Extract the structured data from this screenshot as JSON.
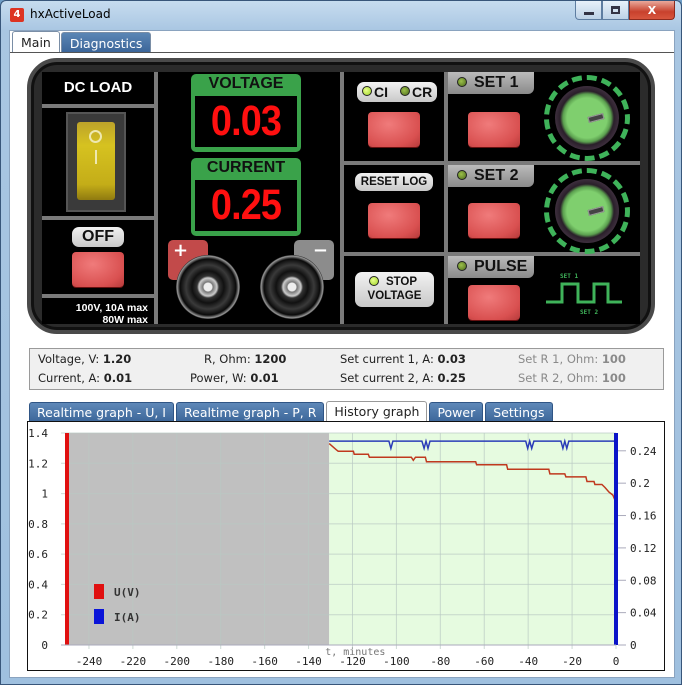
{
  "window": {
    "title": "hxActiveLoad",
    "app_icon": "app-logo-icon",
    "controls": {
      "minimize": "—",
      "maximize": "▫",
      "close": "X"
    }
  },
  "main_tabs": [
    {
      "label": "Main",
      "active": true
    },
    {
      "label": "Diagnostics",
      "active": false
    }
  ],
  "panel": {
    "title": "DC LOAD",
    "power_switch": {
      "icon": "rocker-switch-icon",
      "state": "on"
    },
    "off_button_label": "OFF",
    "specs": [
      "100V, 10A max",
      "80W max"
    ],
    "voltage": {
      "label": "VOLTAGE",
      "value": "0.03"
    },
    "current": {
      "label": "CURRENT",
      "value": "0.25"
    },
    "terminals": {
      "positive": "+",
      "negative": "−"
    },
    "mode_indicator": {
      "ci_label": "CI",
      "cr_label": "CR",
      "ci_lit": true,
      "cr_lit": false
    },
    "reset_log_label": "RESET LOG",
    "stop_voltage_label_1": "STOP",
    "stop_voltage_label_2": "VOLTAGE",
    "set1_label": "SET 1",
    "set2_label": "SET 2",
    "pulse_label": "PULSE",
    "pulse_diagram": {
      "top_label": "SET 1",
      "bottom_label": "SET 2"
    },
    "colors": {
      "display_red": "#ff1010",
      "meter_green": "#3aa24a",
      "button_red": "#d95050"
    }
  },
  "info": {
    "voltage_label": "Voltage, V:",
    "voltage_value": "1.20",
    "current_label": "Current, A:",
    "current_value": "0.01",
    "r_label": "R, Ohm:",
    "r_value": "1200",
    "power_label": "Power, W:",
    "power_value": "0.01",
    "set_current1_label": "Set current 1, A:",
    "set_current1_value": "0.03",
    "set_current2_label": "Set current 2, A:",
    "set_current2_value": "0.25",
    "set_r1_label": "Set R 1, Ohm:",
    "set_r1_value": "100",
    "set_r2_label": "Set R 2, Ohm:",
    "set_r2_value": "100"
  },
  "graph_tabs": [
    {
      "label": "Realtime graph - U, I",
      "active": false
    },
    {
      "label": "Realtime graph - P, R",
      "active": false
    },
    {
      "label": "History graph",
      "active": true
    },
    {
      "label": "Power",
      "active": false
    },
    {
      "label": "Settings",
      "active": false
    }
  ],
  "chart_data": {
    "type": "line",
    "title": "",
    "xlabel": "t, minutes",
    "ylabel_left": "U(V)",
    "ylabel_right": "I(A)",
    "xlim": [
      -250,
      0
    ],
    "ylim_left": [
      0,
      1.4
    ],
    "ylim_right": [
      0,
      0.262
    ],
    "x_ticks": [
      -240,
      -220,
      -200,
      -180,
      -160,
      -140,
      -120,
      -100,
      -80,
      -60,
      -40,
      -20,
      0
    ],
    "y_ticks_left": [
      0,
      0.2,
      0.4,
      0.6,
      0.8,
      1,
      1.2,
      1.4
    ],
    "y_ticks_right": [
      0,
      0.04,
      0.08,
      0.12,
      0.16,
      0.2,
      0.24
    ],
    "grid": true,
    "legend": {
      "placement": "bottom-left",
      "entries": [
        {
          "label": "U(V)",
          "color": "#e01010"
        },
        {
          "label": "I(A)",
          "color": "#0a14d8"
        }
      ]
    },
    "no_data_region": {
      "from": -250,
      "to": -130.6,
      "color": "#c0c0c0"
    },
    "data_region_color": "#e6fbe0",
    "series": [
      {
        "name": "U(V)",
        "axis": "left",
        "color": "#c0391e",
        "x": [
          -130.6,
          -127.4,
          -126.5,
          -119.6,
          -119.2,
          -112.8,
          -112.3,
          -93.2,
          -92.3,
          -91.3,
          -90.4,
          -86.8,
          -86.3,
          -63.9,
          -63.5,
          -49.8,
          -49.3,
          -30.6,
          -30.1,
          -23.3,
          -22.8,
          -13.7,
          -13.2,
          -10.0,
          -9.6,
          -6.4,
          -5.0,
          -3.2,
          -1.4,
          0
        ],
        "y": [
          1.33,
          1.29,
          1.28,
          1.28,
          1.26,
          1.26,
          1.24,
          1.24,
          1.22,
          1.24,
          1.24,
          1.24,
          1.21,
          1.21,
          1.19,
          1.19,
          1.16,
          1.16,
          1.13,
          1.13,
          1.11,
          1.11,
          1.08,
          1.08,
          1.06,
          1.06,
          1.04,
          1.01,
          0.99,
          0.94
        ]
      },
      {
        "name": "I(A)",
        "axis": "right",
        "color": "#2a3cb8",
        "x": [
          -130.6,
          -103.4,
          -102.5,
          -101.6,
          -88.4,
          -87.4,
          -86.5,
          -85.6,
          -84.7,
          -83.8,
          -41.1,
          -40.2,
          -39.3,
          -38.4,
          -37.4,
          -36.5,
          -25.1,
          -24.2,
          -23.3,
          -22.4,
          -21.5,
          -20.5,
          0
        ],
        "y": [
          0.252,
          0.252,
          0.243,
          0.252,
          0.252,
          0.243,
          0.252,
          0.243,
          0.252,
          0.252,
          0.252,
          0.243,
          0.252,
          0.243,
          0.252,
          0.252,
          0.252,
          0.243,
          0.252,
          0.243,
          0.252,
          0.252,
          0.252
        ]
      }
    ]
  }
}
